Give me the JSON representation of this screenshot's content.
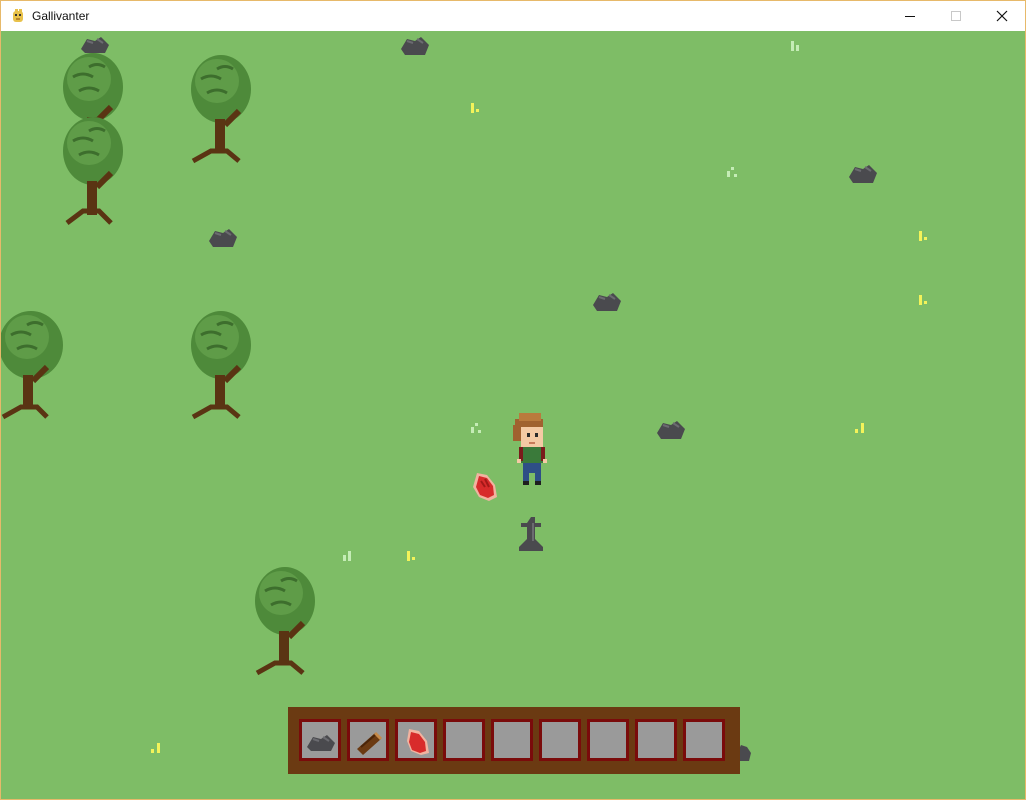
{
  "window": {
    "title": "Gallivanter",
    "app_icon": "pygame-snake-icon",
    "controls": [
      "minimize-icon",
      "maximize-icon",
      "close-icon"
    ]
  },
  "world": {
    "background_color": "#7ebd66",
    "entities": [
      "player",
      "tree",
      "rock",
      "raw-meat",
      "grass-tuft",
      "stone-marker"
    ]
  },
  "hotbar": {
    "slots": [
      {
        "item": "rock-icon"
      },
      {
        "item": "wood-log-icon"
      },
      {
        "item": "raw-meat-icon"
      },
      {
        "item": ""
      },
      {
        "item": ""
      },
      {
        "item": ""
      },
      {
        "item": ""
      },
      {
        "item": ""
      },
      {
        "item": ""
      }
    ],
    "selected_slot": 1
  }
}
